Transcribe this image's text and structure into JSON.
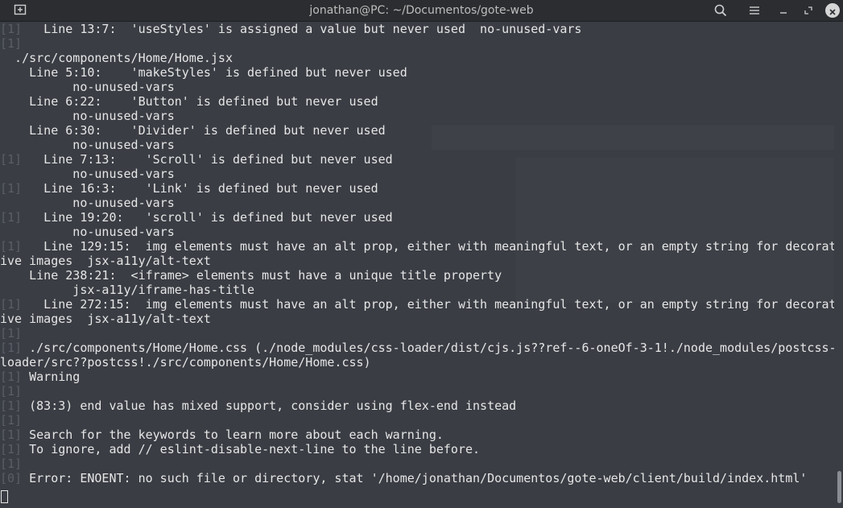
{
  "window": {
    "title": "jonathan@PC: ~/Documentos/gote-web"
  },
  "icons": {
    "new_tab": "new-tab-icon",
    "search": "search-icon",
    "menu": "hamburger-menu-icon",
    "minimize": "minimize-icon",
    "maximize": "maximize-icon",
    "close": "close-icon"
  },
  "colors": {
    "background": "#3a3d44",
    "titlebar": "#2b2d30",
    "text": "#e6e6e6",
    "gutter": "#5a5e66"
  },
  "terminal": {
    "lines": [
      {
        "prefix": "[1]",
        "text": "   Line 13:7:  'useStyles' is assigned a value but never used  no-unused-vars"
      },
      {
        "prefix": "[1]",
        "text": ""
      },
      {
        "prefix": "",
        "text": "  ./src/components/Home/Home.jsx"
      },
      {
        "prefix": "",
        "text": "    Line 5:10:    'makeStyles' is defined but never used"
      },
      {
        "prefix": "",
        "text": "          no-unused-vars"
      },
      {
        "prefix": "",
        "text": "    Line 6:22:    'Button' is defined but never used"
      },
      {
        "prefix": "",
        "text": "          no-unused-vars"
      },
      {
        "prefix": "",
        "text": "    Line 6:30:    'Divider' is defined but never used"
      },
      {
        "prefix": "",
        "text": "          no-unused-vars"
      },
      {
        "prefix": "[1]",
        "text": "   Line 7:13:    'Scroll' is defined but never used"
      },
      {
        "prefix": "",
        "text": "          no-unused-vars"
      },
      {
        "prefix": "[1]",
        "text": "   Line 16:3:    'Link' is defined but never used"
      },
      {
        "prefix": "",
        "text": "          no-unused-vars"
      },
      {
        "prefix": "[1]",
        "text": "   Line 19:20:   'scroll' is defined but never used"
      },
      {
        "prefix": "",
        "text": "          no-unused-vars"
      },
      {
        "prefix": "[1]",
        "text": "   Line 129:15:  img elements must have an alt prop, either with meaningful text, or an empty string for decorat"
      },
      {
        "prefix": "",
        "text": "ive images  jsx-a11y/alt-text"
      },
      {
        "prefix": "",
        "text": "    Line 238:21:  <iframe> elements must have a unique title property"
      },
      {
        "prefix": "",
        "text": "          jsx-a11y/iframe-has-title"
      },
      {
        "prefix": "[1]",
        "text": "   Line 272:15:  img elements must have an alt prop, either with meaningful text, or an empty string for decorat"
      },
      {
        "prefix": "",
        "text": "ive images  jsx-a11y/alt-text"
      },
      {
        "prefix": "[1]",
        "text": ""
      },
      {
        "prefix": "[1]",
        "text": " ./src/components/Home/Home.css (./node_modules/css-loader/dist/cjs.js??ref--6-oneOf-3-1!./node_modules/postcss-"
      },
      {
        "prefix": "",
        "text": "loader/src??postcss!./src/components/Home/Home.css)"
      },
      {
        "prefix": "[1]",
        "text": " Warning"
      },
      {
        "prefix": "[1]",
        "text": ""
      },
      {
        "prefix": "[1]",
        "text": " (83:3) end value has mixed support, consider using flex-end instead"
      },
      {
        "prefix": "[1]",
        "text": ""
      },
      {
        "prefix": "[1]",
        "text": " Search for the keywords to learn more about each warning."
      },
      {
        "prefix": "[1]",
        "text": " To ignore, add // eslint-disable-next-line to the line before."
      },
      {
        "prefix": "[1]",
        "text": ""
      },
      {
        "prefix": "[0]",
        "text": " Error: ENOENT: no such file or directory, stat '/home/jonathan/Documentos/gote-web/client/build/index.html'"
      }
    ]
  }
}
